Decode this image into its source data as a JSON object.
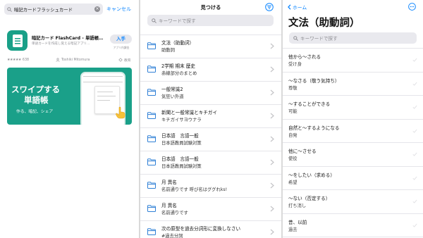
{
  "appstore": {
    "search_text": "暗記カードフラッシュカード",
    "cancel_label": "キャンセル",
    "app_name": "暗記カード FlashCard - 単語帳…",
    "app_subtitle": "単語カードを作成し覚える暗記アプリ…",
    "get_label": "入手",
    "get_note": "アプリ内課金",
    "rating_stars": "★★★★★",
    "rating_count": "638",
    "developer": "Toshiki Mitomura",
    "category": "教育",
    "banner_line1": "スワイプする",
    "banner_line2": "単語帳",
    "banner_line3": "作る、暗記、シェア",
    "brand_color": "#1aa089"
  },
  "find": {
    "title": "見つける",
    "search_placeholder": "キーワードで探す",
    "decks": [
      {
        "title": "文法（助動詞）",
        "subtitle": "助動詞"
      },
      {
        "title": "2学期 期末 歴史",
        "subtitle": "赤線部分のまとめ"
      },
      {
        "title": "一般常識2",
        "subtitle": "気狂い外道"
      },
      {
        "title": "新聞と一般常識とキチガイ",
        "subtitle": "キチガイサヨウナラ"
      },
      {
        "title": "日本語　言語一般",
        "subtitle": "日本語教員試験対策"
      },
      {
        "title": "日本語　言語一般",
        "subtitle": "日本語教員試験対策"
      },
      {
        "title": "月 異名",
        "subtitle": "名前通りです 呼び名はググれks!"
      },
      {
        "title": "月 異名",
        "subtitle": "名前通りです"
      },
      {
        "title": "次の原型を過去分詞形に変換しなさい",
        "subtitle": "#過去分詞"
      }
    ]
  },
  "deck": {
    "back_label": "ホーム",
    "title": "文法（助動詞）",
    "search_placeholder": "キーワードで探す",
    "cards": [
      {
        "front": "他から〜される",
        "back": "受け身"
      },
      {
        "front": "〜なさる（敬う気持ち）",
        "back": "尊敬"
      },
      {
        "front": "〜することができる",
        "back": "可能"
      },
      {
        "front": "自然と〜するようになる",
        "back": "自発"
      },
      {
        "front": "他に〜させる",
        "back": "使役"
      },
      {
        "front": "〜をしたい（求める）",
        "back": "希望"
      },
      {
        "front": "〜ない（否定する）",
        "back": "打ち消し"
      },
      {
        "front": "昔、以前",
        "back": "過去"
      }
    ]
  },
  "colors": {
    "accent": "#0a84ff",
    "folder": "#2f80d6"
  }
}
